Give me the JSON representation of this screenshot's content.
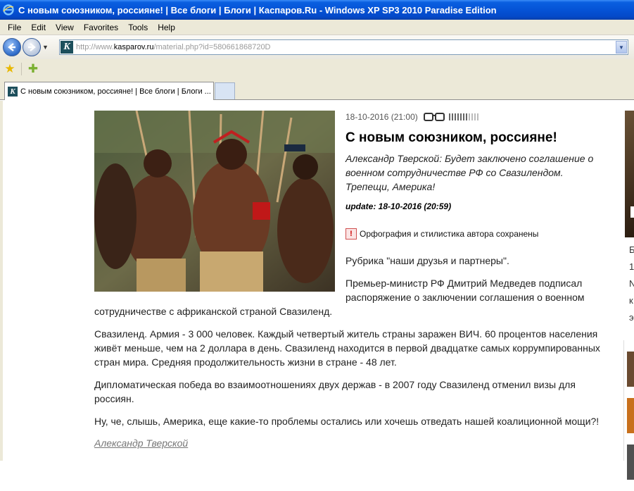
{
  "window": {
    "title": "С новым союзником, россияне! | Все блоги | Блоги | Каспаров.Ru - Windows XP SP3 2010 Paradise Edition"
  },
  "menu": {
    "items": [
      {
        "label": "File"
      },
      {
        "label": "Edit"
      },
      {
        "label": "View"
      },
      {
        "label": "Favorites"
      },
      {
        "label": "Tools"
      },
      {
        "label": "Help"
      }
    ]
  },
  "address": {
    "prefix": "http://www.",
    "host": "kasparov.ru",
    "path": "/material.php?id=580661868720D"
  },
  "tab": {
    "label": "С новым союзником, россияне! | Все блоги | Блоги ..."
  },
  "article": {
    "date": "18-10-2016 (21:00)",
    "title": "С новым союзником, россияне!",
    "lead": "Александр Тверской: Будет заключено соглашение о военном сотрудничестве РФ со Свазилендом. Трепещи, Америка!",
    "update": "update: 18-10-2016 (20:59)",
    "notice": "Орфография и стилистика автора сохранены",
    "rubric": "Рубрика \"наши друзья и партнеры\".",
    "p1_a": "Премьер-министр РФ Дмитрий Медведев подписал",
    "p1_b": "распоряжение о заключении соглашения о военном",
    "p1_c": "сотрудничестве с африканской страной Свазиленд.",
    "p2": "Свазиленд. Армия - 3 000 человек. Каждый четвертый житель страны заражен ВИЧ. 60 процентов населения живёт меньше, чем на 2 доллара в день. Свазиленд находится в первой двадцатке самых коррумпированных стран мира. Средняя продолжительность жизни в стране - 48 лет.",
    "p3": "Дипломатическая победа во взаимоотношениях двух держав - в 2007 году Свазиленд отменил визы для россиян.",
    "p4": "Ну, че, слышь, Америка, еще какие-то проблемы остались или хочешь отведать нашей коалиционной мощи?!",
    "author": "Александр Тверской"
  },
  "right_column": {
    "chars": [
      "Б",
      "1",
      "N",
      "к",
      "э"
    ]
  }
}
